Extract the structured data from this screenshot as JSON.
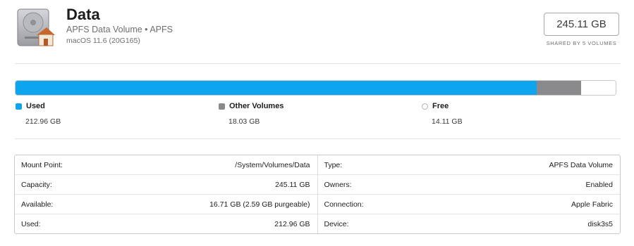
{
  "volume": {
    "name": "Data",
    "subtitle": "APFS Data Volume • APFS",
    "os_version": "macOS 11.6 (20G165)",
    "capacity": "245.11 GB",
    "shared_label": "SHARED BY 5 VOLUMES"
  },
  "usage": {
    "fractions": {
      "used": 0.8688,
      "other": 0.0736,
      "free": 0.0576
    },
    "legend": [
      {
        "label": "Used",
        "value": "212.96 GB",
        "color": "#0ea5ef"
      },
      {
        "label": "Other Volumes",
        "value": "18.03 GB",
        "color": "#8a8a8c"
      },
      {
        "label": "Free",
        "value": "14.11 GB",
        "color": "#ffffff"
      }
    ]
  },
  "info": {
    "left": [
      {
        "label": "Mount Point:",
        "value": "/System/Volumes/Data"
      },
      {
        "label": "Capacity:",
        "value": "245.11 GB"
      },
      {
        "label": "Available:",
        "value": "16.71 GB (2.59 GB purgeable)"
      },
      {
        "label": "Used:",
        "value": "212.96 GB"
      }
    ],
    "right": [
      {
        "label": "Type:",
        "value": "APFS Data Volume"
      },
      {
        "label": "Owners:",
        "value": "Enabled"
      },
      {
        "label": "Connection:",
        "value": "Apple Fabric"
      },
      {
        "label": "Device:",
        "value": "disk3s5"
      }
    ]
  }
}
